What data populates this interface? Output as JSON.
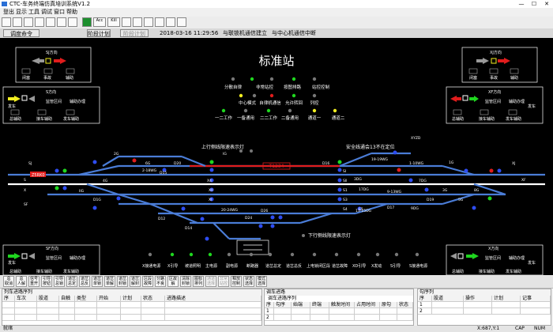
{
  "window": {
    "title": "CTC-车务终端仿真培训系统V1.2",
    "controls": [
      "—",
      "☐",
      "✕"
    ]
  },
  "menu": [
    "登出",
    "显示",
    "工具",
    "调试",
    "窗口",
    "帮助"
  ],
  "toolbar": {
    "labels": [
      "Acc",
      "Kill"
    ]
  },
  "status_line": {
    "mode_button": "调度命令",
    "plan_button": "阶段计划",
    "plan_button2": "阶段计划",
    "datetime": "2018-03-16 11:29:56",
    "link1": "与联锁机通信建立",
    "link2": "与中心机通信中断"
  },
  "station": {
    "name": "标准站",
    "control_row1": [
      "分散自律",
      "非常站控",
      "按图排路",
      "站控控制"
    ],
    "control_row2": [
      "中心模式",
      "自律机通信",
      "允许转回",
      "列控"
    ],
    "control_row3": [
      "一二工作",
      "一备通用",
      "二二工作",
      "二备通用",
      "通道一",
      "通道二"
    ],
    "upper_note": "上行侧线限速表示灯",
    "lower_note": "下行侧线限速表示灯",
    "safety_note": "安全线通会13不在定位",
    "train_label": "T1234",
    "direction_boxes": [
      {
        "name": "SJ方向",
        "labels": [
          "闭塞",
          "事故",
          "辅助"
        ]
      },
      {
        "name": "XJ方向",
        "labels": [
          "闭塞",
          "事故",
          "辅助"
        ]
      },
      {
        "name": "S方向",
        "labels": [
          "发车",
          "监管区间",
          "辅助办理",
          "总辅助",
          "接车辅助",
          "发车辅助"
        ]
      },
      {
        "name": "XF方向",
        "labels": [
          "发车",
          "监管区间",
          "辅助办理",
          "总辅助",
          "接车辅助",
          "发车辅助"
        ]
      },
      {
        "name": "SF方向",
        "labels": [
          "发车",
          "监管区间",
          "辅助办理",
          "总辅助",
          "接车辅助",
          "发车辅助"
        ]
      },
      {
        "name": "X方向",
        "labels": [
          "发车",
          "监管区间",
          "辅助办理",
          "总辅助",
          "接车辅助",
          "发车辅助"
        ]
      }
    ],
    "track_labels": [
      "SJ",
      "S",
      "X",
      "SF",
      "XF",
      "XJ",
      "1G",
      "2G",
      "3G",
      "4G",
      "5G",
      "6G",
      "IG",
      "IIG",
      "3DG",
      "9DG",
      "17DG",
      "1-10WG",
      "2-18WG",
      "20-24WG",
      "D1G",
      "D12",
      "D14",
      "D15",
      "D20",
      "D24",
      "D26",
      "X4",
      "XII",
      "XI",
      "S1",
      "S3",
      "S4",
      "S5",
      "SII",
      "SI",
      "XYZD",
      "19-19WG",
      "11-15DG",
      "9-13WG",
      "D16",
      "D17",
      "D19",
      "8G",
      "7DG"
    ],
    "lower_labels": [
      "X接通电源",
      "X引导",
      "坡道照明",
      "主电源",
      "副电源",
      "断路器",
      "道岔总定",
      "道岔总反",
      "上电锁闭区段",
      "道岔故障",
      "XD引导",
      "X发动",
      "S引导",
      "S接通电源"
    ],
    "left_stub": "Z5RK0"
  },
  "ctrl_buttons": [
    {
      "l1": "总",
      "l2": "取消"
    },
    {
      "l1": "总",
      "l2": "人解"
    },
    {
      "l1": "信号",
      "l2": "重开"
    },
    {
      "l1": "引导",
      "l2": "按钮"
    },
    {
      "l1": "引导",
      "l2": "总锁"
    },
    {
      "l1": "道岔",
      "l2": "总定"
    },
    {
      "l1": "道岔",
      "l2": "总反"
    },
    {
      "l1": "道岔",
      "l2": "单锁"
    },
    {
      "l1": "道岔",
      "l2": "单解"
    },
    {
      "l1": "道岔",
      "l2": "封锁"
    },
    {
      "l1": "道岔",
      "l2": "解封"
    },
    {
      "l1": "区段",
      "l2": "故障"
    },
    {
      "l1": "分路",
      "l2": "不良"
    },
    {
      "l1": "区故",
      "l2": "解"
    },
    {
      "l1": "清除",
      "l2": "封锁"
    },
    {
      "l1": "图标",
      "l2": "排列"
    },
    {
      "l1": "通道",
      "l2": "选择"
    },
    {
      "l1": "非常",
      "l2": "站控"
    },
    {
      "l1": "释放",
      "l2": "控制"
    },
    {
      "l1": "状态",
      "l2": "选择"
    },
    {
      "l1": "模式",
      "l2": "选择"
    }
  ],
  "panels": {
    "left": {
      "title": "列车进路序列",
      "headers": [
        "序",
        "车次",
        "股道",
        "自触",
        "类型",
        "开始",
        "计划",
        "状态",
        "进路描述"
      ],
      "rows": [
        [
          ""
        ],
        [
          ""
        ],
        [
          ""
        ]
      ]
    },
    "middle": {
      "title": "调车进路",
      "subtitle": "调车进路序列",
      "headers": [
        "序",
        "勾序",
        "始端",
        "终端",
        "触发时间",
        "占用时间",
        "原勾",
        "状态"
      ],
      "rows": [
        [
          "1"
        ],
        [
          "2"
        ]
      ]
    },
    "right": {
      "title": "勾序列",
      "headers": [
        "序",
        "股道",
        "操作",
        "计划",
        "记事"
      ],
      "rows": [
        [
          "1"
        ],
        [
          "2"
        ]
      ]
    }
  },
  "status_bottom": {
    "left": "就绪",
    "coords": "X:687,Y:1",
    "caps": "CAP",
    "num": "NUM"
  },
  "colors": {
    "green": "#1fd61f",
    "red": "#e01c1c",
    "yellow": "#f2ee21",
    "white": "#ffffff",
    "blue": "#2e4df2",
    "track": "#4a7cd6",
    "grey": "#777777"
  }
}
